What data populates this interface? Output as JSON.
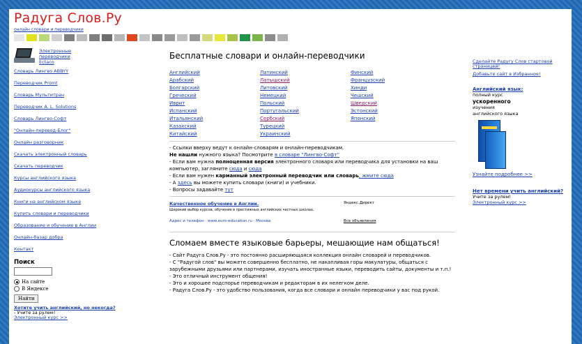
{
  "logo": {
    "title": "Радуга Слов.Ру",
    "subtitle": "онлайн словари и переводчики"
  },
  "palette": [
    "#e6e6e6",
    "#e2e11f",
    "#b8d87a",
    "#cfcfcf",
    "#7f7f7f",
    "#bcbcbc",
    "#7f7f7f",
    "#6e6e6e",
    "#b7b7b7",
    "#e0471e",
    "#c4c4c4",
    "#8a8a8a",
    "#9a9a9a",
    "#bfbfbf",
    "#9a9a9a",
    "#d8d87e",
    "#e8e83c",
    "#a6c34a",
    "#1e9448",
    "#7ab44a",
    "#8c8c8c",
    "#b0b0b0"
  ],
  "left": {
    "ecta": "Электронные переводчики Ectaco",
    "items": [
      "Словарь Лингво ABBYY",
      "Переводчик Promt",
      "Словарь Мультитран",
      "Переводчик A. L. Solutions",
      "Словарь Лингво-Софт",
      "\"Онлайн-перевод-Блог\"",
      "Онлайн разговорник",
      "Скачать электронный словарь",
      "Скачать переводчик",
      "Курсы английского языка",
      "Аудиокурсы английского языка",
      "Книги на английском языке",
      "Купить словари и переводчики",
      "Образование и обучение в Англии",
      "Онлайн-базар добра",
      "Контакт"
    ],
    "search_label": "Поиск",
    "search_value": "",
    "radio1": "На сайте",
    "radio2": "В Яндексе",
    "button": "Найти",
    "promo_title": "Хотите учить английский, но некогда?",
    "promo_line1": "- Учите за рулем!",
    "promo_line2": "Электронный курс >>"
  },
  "center": {
    "title": "Бесплатные словари и онлайн-переводчики",
    "col1": [
      "Английский",
      "Арабский",
      "Болгарский",
      "Греческий",
      "Иврит",
      "Испанский",
      "Итальянский",
      "Казахский",
      "Китайский"
    ],
    "col2": [
      "Латинский",
      "Латышский",
      "Литовский",
      "Немецкий",
      "Польский",
      "Португальский",
      "Сербский",
      "Турецкий",
      "Украинский"
    ],
    "col3": [
      "Финский",
      "Французский",
      "Хинди",
      "Чешский",
      "Шведский",
      "Эстонский",
      "Японский"
    ],
    "n1": "- Ссылки вверху ведут к онлайн-словарям и онлайн-переводчикам.",
    "n2a": "Не нашли",
    "n2b": " нужного языка? Посмотрите ",
    "n2c": "в словаре \"Лингво-Софт\"",
    "n3a": "- Если вам нужна ",
    "n3b": "полноценная версия",
    "n3c": " электронного словаря или переводчика для установки на ваш компьютер, загляните ",
    "n3d": "сюда",
    "n3e": " и ",
    "n3f": "сюда",
    "n4a": "- Если вам нужен ",
    "n4b": "карманный электронный переводчик или словарь",
    "n4c": ", жмите сюда",
    "n5a": "- А ",
    "n5b": "здесь",
    "n5c": " вы можете купить словари (книги) и учебники.",
    "n6a": "- Вопросы задавайте ",
    "n6b": "тут",
    "ad_title": "Качественное обучение в Англии.",
    "ad_text": "Широкий выбор курсов, обучение в престижных английских частных школах.",
    "ad_footer": "Адрес и телефон · www.euro-education.ru · Москва",
    "ad_yandex": "Яндекс.Директ",
    "ad_all": "Все объявления",
    "title2": "Сломаем вместе языковые барьеры, мешающие нам общаться!",
    "p1": "- Сайт Радуга Слов.Ру - это постоянно расширяющаяся коллекция онлайн словарей и переводчиков.",
    "p2": "- С \"Радугой слов\" вы можете совершенно бесплатно, не накапливая горы макулатуры, общаться с зарубежными друзьями или партнерами, изучать иностранные языки, переводить сайты, документы и т.п.!",
    "p3": "- Это отличный инструмент общения!",
    "p4": "- Это и хорошее подспорье переводчикам и редакторам в их нелегком деле.",
    "p5": "- Радуга Слов.Ру - это удобство пользования, когда все словари и онлайн переводчики у вас под рукой."
  },
  "right": {
    "l1": "Сделайте Радугу Слов стартовой страницей!",
    "l2": "Добавьте сайт в Избранное!",
    "eng_h": "Английский язык:",
    "eng_1": "полный курс",
    "eng_2": "ускоренного",
    "eng_3": "изучения",
    "eng_4": "английского языка",
    "learn": "Узнайте подробнее >>",
    "nt_h": "Нет времени учить английский?",
    "nt_1": "Учите за рулем!",
    "nt_2": "Электронный курс >>"
  }
}
